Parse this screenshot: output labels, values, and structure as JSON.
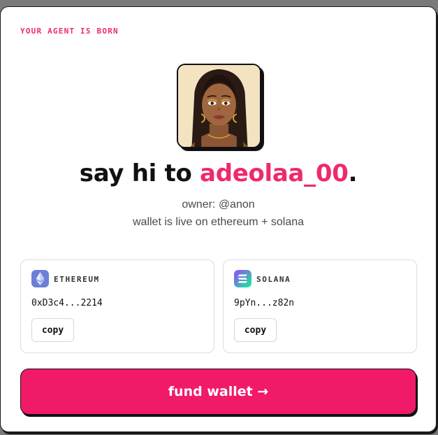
{
  "card": {
    "eyebrow": "YOUR AGENT IS BORN"
  },
  "agent": {
    "greeting": "say hi to ",
    "name": "adeolaa_00",
    "period": ".",
    "owner_line": "owner: @anon",
    "status_line": "wallet is live on ethereum + solana",
    "avatar_alt": "agent avatar"
  },
  "wallets": [
    {
      "chain": "ETHEREUM",
      "icon": "ethereum-icon",
      "address": "0xD3c4...2214",
      "copy_label": "copy"
    },
    {
      "chain": "SOLANA",
      "icon": "solana-icon",
      "address": "9pYn...z82n",
      "copy_label": "copy"
    }
  ],
  "actions": {
    "fund_label": "fund wallet →"
  },
  "colors": {
    "accent": "#ee2a6b",
    "button": "#f11a68",
    "ethereum": "#6b7fd6",
    "solana_gradient": [
      "#9945ff",
      "#14f195"
    ]
  }
}
